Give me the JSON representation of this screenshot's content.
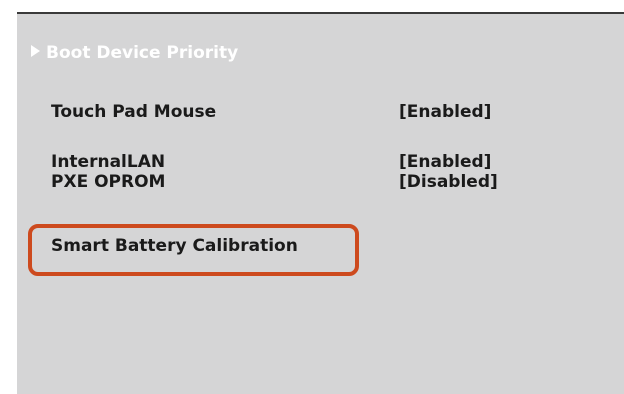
{
  "submenu": {
    "icon": "triangle-right-icon",
    "label": "Boot Device Priority"
  },
  "settings": [
    {
      "label": "Touch Pad Mouse",
      "value": "[Enabled]"
    },
    {
      "label": "InternalLAN",
      "value": "[Enabled]"
    },
    {
      "label": "PXE OPROM",
      "value": "[Disabled]"
    },
    {
      "label": "Smart Battery Calibration",
      "value": ""
    }
  ],
  "colors": {
    "panel_background": "#d5d5d6",
    "highlight_border": "#cd4a1e",
    "submenu_text": "#ffffff"
  }
}
